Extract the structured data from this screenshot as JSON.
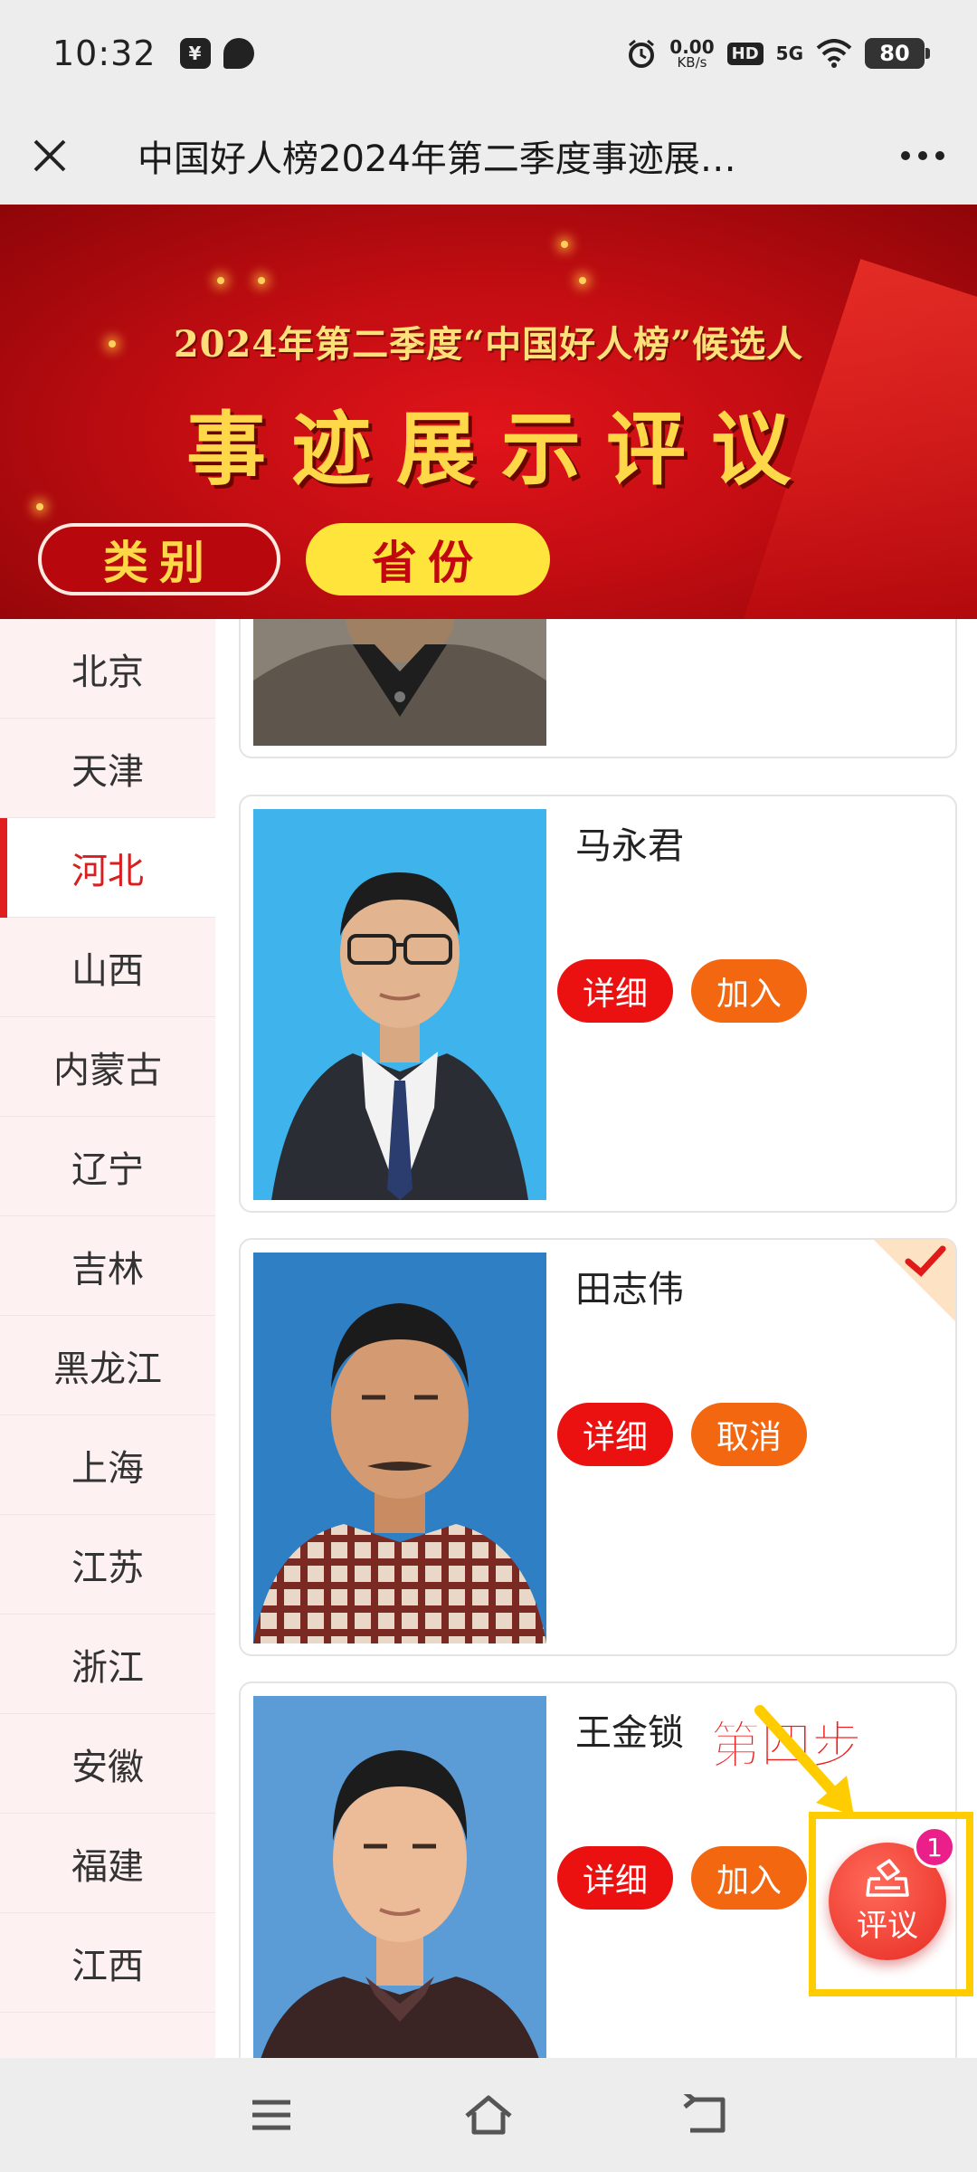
{
  "status_bar": {
    "time": "10:32",
    "net_speed_value": "0.00",
    "net_speed_unit": "KB/s",
    "hd": "HD",
    "network": "5G",
    "battery": "80"
  },
  "nav": {
    "title": "中国好人榜2024年第二季度事迹展…"
  },
  "banner": {
    "subtitle": "2024年第二季度“中国好人榜”候选人",
    "title": "事迹展示评议",
    "tabs": [
      {
        "label": "类别"
      },
      {
        "label": "省份"
      }
    ]
  },
  "sidebar": {
    "items": [
      {
        "label": "北京"
      },
      {
        "label": "天津"
      },
      {
        "label": "河北"
      },
      {
        "label": "山西"
      },
      {
        "label": "内蒙古"
      },
      {
        "label": "辽宁"
      },
      {
        "label": "吉林"
      },
      {
        "label": "黑龙江"
      },
      {
        "label": "上海"
      },
      {
        "label": "江苏"
      },
      {
        "label": "浙江"
      },
      {
        "label": "安徽"
      },
      {
        "label": "福建"
      },
      {
        "label": "江西"
      }
    ],
    "active": "河北"
  },
  "cards": [
    {
      "name": "马永君",
      "detail_label": "详细",
      "action_label": "加入",
      "selected": false
    },
    {
      "name": "田志伟",
      "detail_label": "详细",
      "action_label": "取消",
      "selected": true
    },
    {
      "name": "王金锁",
      "detail_label": "详细",
      "action_label": "加入",
      "selected": false
    }
  ],
  "annotation": {
    "step_label": "第四步"
  },
  "fab": {
    "label": "评议",
    "badge": "1"
  },
  "colors": {
    "accent_red": "#ec1111",
    "accent_orange": "#f2670f",
    "highlight_yellow": "#ffcc00",
    "badge_pink": "#ea1f8a"
  }
}
